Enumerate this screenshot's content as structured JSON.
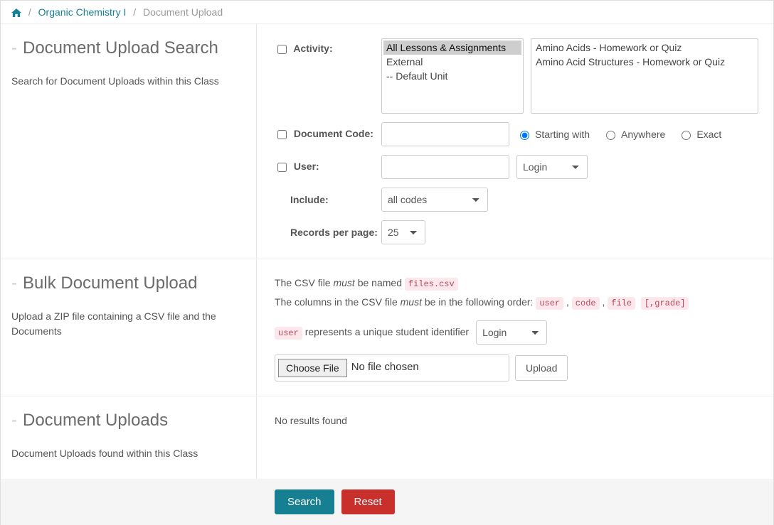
{
  "breadcrumb": {
    "course": "Organic Chemistry I",
    "current": "Document Upload"
  },
  "sections": {
    "search": {
      "title": "Document Upload Search",
      "desc": "Search for Document Uploads within this Class"
    },
    "bulk": {
      "title": "Bulk Document Upload",
      "desc": "Upload a ZIP file containing a CSV file and the Documents"
    },
    "uploads": {
      "title": "Document Uploads",
      "desc": "Document Uploads found within this Class"
    }
  },
  "form": {
    "labels": {
      "activity": "Activity:",
      "doc_code": "Document Code:",
      "user": "User:",
      "include": "Include:",
      "rpp": "Records per page:"
    },
    "activity_options": {
      "o0": "All Lessons & Assignments",
      "o1": "External",
      "o2": "-- Default Unit"
    },
    "assignment_options": {
      "o0": "Amino Acids - Homework or Quiz",
      "o1": "Amino Acid Structures - Homework or Quiz"
    },
    "radio": {
      "starting": "Starting with",
      "anywhere": "Anywhere",
      "exact": "Exact"
    },
    "user_select_value": "Login",
    "include_value": "all codes",
    "rpp_value": "25"
  },
  "bulk": {
    "line1_pre": "The CSV file ",
    "line1_em": "must",
    "line1_post": " be named ",
    "filename": "files.csv",
    "line2_pre": "The columns in the CSV file ",
    "line2_em": "must",
    "line2_post": " be in the following order: ",
    "col_user": "user",
    "col_code": "code",
    "col_file": "file",
    "col_grade": "[,grade]",
    "sep": " , ",
    "user_rep_code": "user",
    "user_rep_text": " represents a unique student identifier",
    "bulk_select_value": "Login",
    "choose_label": "Choose File",
    "file_status": "No file chosen",
    "upload_label": "Upload"
  },
  "results": {
    "none": "No results found"
  },
  "buttons": {
    "search": "Search",
    "reset": "Reset"
  }
}
